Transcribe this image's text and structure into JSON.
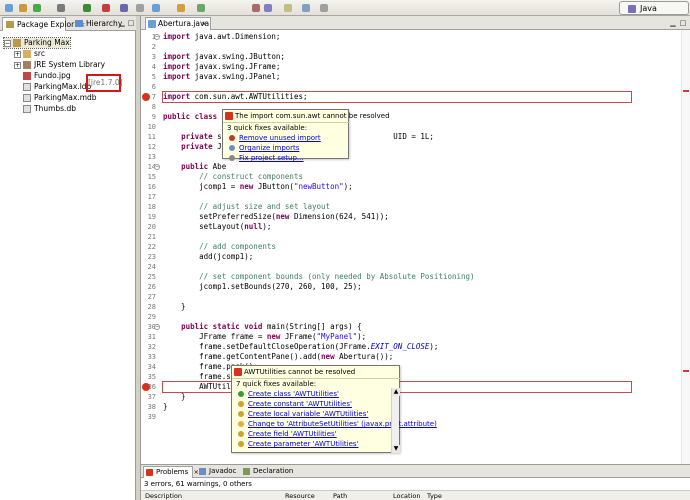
{
  "toolbar": {
    "perspective_label": "Java",
    "colors": [
      "#6a9fd6",
      "#c89a3a",
      "#4aa84a",
      "#7a7a7a",
      "#3a8a3a",
      "#c04040",
      "#6a6aa8",
      "#a0a0a0",
      "#6a9fd6",
      "#d0a040",
      "#6aa86a",
      "#a86a6a",
      "#8080c0",
      "#c0c080",
      "#80a0c0",
      "#a0a0a0"
    ]
  },
  "left_panel": {
    "tabs": [
      {
        "label": "Package Explor",
        "close": "×"
      },
      {
        "label": "Hierarchy",
        "close": ""
      }
    ],
    "tree": [
      {
        "label": "Parking Max",
        "icon": "project-icon",
        "expander": "−",
        "indent": 0
      },
      {
        "label": "src",
        "icon": "package-folder-icon",
        "expander": "+",
        "indent": 1
      },
      {
        "label": "JRE System Library",
        "icon": "library-icon",
        "expander": "+",
        "indent": 1
      },
      {
        "label": "Fundo.jpg",
        "icon": "image-file-icon",
        "expander": "",
        "indent": 1
      },
      {
        "label": "ParkingMax.ldb",
        "icon": "file-icon",
        "expander": "",
        "indent": 1
      },
      {
        "label": "ParkingMax.mdb",
        "icon": "file-icon",
        "expander": "",
        "indent": 1
      },
      {
        "label": "Thumbs.db",
        "icon": "file-icon",
        "expander": "",
        "indent": 1
      }
    ],
    "jre_version": "[jre1.7.0]"
  },
  "editor": {
    "tab_label": "Abertura.java",
    "tab_close": "×",
    "lines": [
      {
        "n": "1",
        "code": "import java.awt.Dimension;",
        "fold": "−"
      },
      {
        "n": "2",
        "code": ""
      },
      {
        "n": "3",
        "code": "import javax.swing.JButton;"
      },
      {
        "n": "4",
        "code": "import javax.swing.JFrame;"
      },
      {
        "n": "5",
        "code": "import javax.swing.JPanel;"
      },
      {
        "n": "6",
        "code": ""
      },
      {
        "n": "7",
        "code": "import com.sun.awt.AWTUtilities;",
        "error": true
      },
      {
        "n": "8",
        "code": ""
      },
      {
        "n": "9",
        "code": "public class A"
      },
      {
        "n": "10",
        "code": ""
      },
      {
        "n": "11",
        "code": "    private st                                     UID = 1L;"
      },
      {
        "n": "12",
        "code": "    private JB"
      },
      {
        "n": "13",
        "code": ""
      },
      {
        "n": "14",
        "code": "    public Abe",
        "fold": "−"
      },
      {
        "n": "15",
        "code": "        // construct components",
        "comment": true
      },
      {
        "n": "16",
        "code": "        jcomp1 = new JButton(\"newButton\");"
      },
      {
        "n": "17",
        "code": ""
      },
      {
        "n": "18",
        "code": "        // adjust size and set layout",
        "comment": true
      },
      {
        "n": "19",
        "code": "        setPreferredSize(new Dimension(624, 541));"
      },
      {
        "n": "20",
        "code": "        setLayout(null);"
      },
      {
        "n": "21",
        "code": ""
      },
      {
        "n": "22",
        "code": "        // add components",
        "comment": true
      },
      {
        "n": "23",
        "code": "        add(jcomp1);"
      },
      {
        "n": "24",
        "code": ""
      },
      {
        "n": "25",
        "code": "        // set component bounds (only needed by Absolute Positioning)",
        "comment": true
      },
      {
        "n": "26",
        "code": "        jcomp1.setBounds(270, 260, 100, 25);"
      },
      {
        "n": "27",
        "code": ""
      },
      {
        "n": "28",
        "code": "    }"
      },
      {
        "n": "29",
        "code": ""
      },
      {
        "n": "30",
        "code": "    public static void main(String[] args) {",
        "fold": "−"
      },
      {
        "n": "31",
        "code": "        JFrame frame = new JFrame(\"MyPanel\");"
      },
      {
        "n": "32",
        "code": "        frame.setDefaultCloseOperation(JFrame.EXIT_ON_CLOSE);"
      },
      {
        "n": "33",
        "code": "        frame.getContentPane().add(new Abertura());"
      },
      {
        "n": "34",
        "code": "        frame.pack();"
      },
      {
        "n": "35",
        "code": "        frame.setVisible(true);"
      },
      {
        "n": "36",
        "code": "        AWTUtilities.setWindowOpacity(frame, 0.5f);",
        "error": true
      },
      {
        "n": "37",
        "code": "    }"
      },
      {
        "n": "38",
        "code": "}"
      },
      {
        "n": "39",
        "code": ""
      }
    ]
  },
  "quickfix_top": {
    "header": "The import com.sun.awt cannot be resolved",
    "subtitle": "3 quick fixes available:",
    "items": [
      {
        "label": "Remove unused import",
        "icon_color": "#c0392b"
      },
      {
        "label": "Organize imports",
        "icon_color": "#6a8fc8"
      },
      {
        "label": "Fix project setup...",
        "icon_color": "#888888"
      }
    ]
  },
  "quickfix_bottom": {
    "header": "AWTUtilities cannot be resolved",
    "subtitle": "7 quick fixes available:",
    "items": [
      {
        "label": "Create class 'AWTUtilities'",
        "icon_color": "#3a9a3a"
      },
      {
        "label": "Create constant 'AWTUtilities'",
        "icon_color": "#d0a030"
      },
      {
        "label": "Create local variable 'AWTUtilities'",
        "icon_color": "#d0a030"
      },
      {
        "label": "Change to 'AttributeSetUtilities' (javax.print.attribute)",
        "icon_color": "#e0b040"
      },
      {
        "label": "Create field 'AWTUtilities'",
        "icon_color": "#d0a030"
      },
      {
        "label": "Create parameter 'AWTUtilities'",
        "icon_color": "#d0a030"
      }
    ],
    "scroll_up": "▲",
    "scroll_down": "▼"
  },
  "bottom_panel": {
    "tabs": [
      {
        "label": "Problems",
        "close": "×"
      },
      {
        "label": "Javadoc"
      },
      {
        "label": "Declaration"
      }
    ],
    "status": "3 errors, 61 warnings, 0 others",
    "columns": [
      "Description",
      "Resource",
      "Path",
      "Location",
      "Type"
    ]
  }
}
